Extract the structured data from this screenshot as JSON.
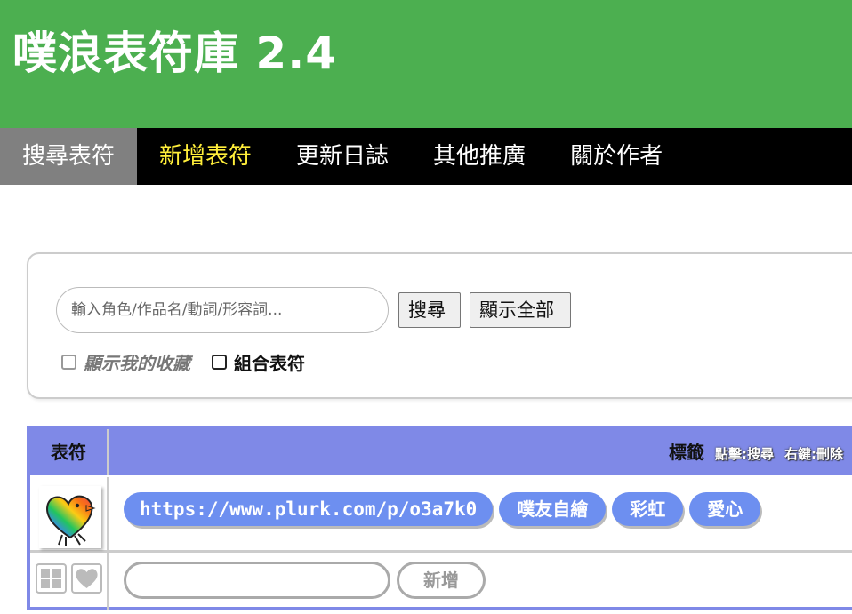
{
  "header": {
    "title": "噗浪表符庫 2.4",
    "background": "#4caf50"
  },
  "nav": [
    {
      "label": "搜尋表符",
      "state": "active"
    },
    {
      "label": "新增表符",
      "state": "highlight"
    },
    {
      "label": "更新日誌",
      "state": "normal"
    },
    {
      "label": "其他推廣",
      "state": "normal"
    },
    {
      "label": "關於作者",
      "state": "normal"
    }
  ],
  "search": {
    "placeholder": "輸入角色/作品名/動詞/形容詞...",
    "value": "",
    "search_button": "搜尋",
    "show_all_button": "顯示全部",
    "show_favorites_label": "顯示我的收藏",
    "show_favorites_checked": false,
    "combine_label": "組合表符",
    "combine_checked": false
  },
  "table": {
    "header_emoji": "表符",
    "header_tags": "標籤",
    "hint_click": "點擊:搜尋",
    "hint_right": "右鍵:刪除",
    "rows": [
      {
        "emoji_icon": "rainbow-heart-bird-icon",
        "tags": [
          "https://www.plurk.com/p/o3a7k0",
          "噗友自繪",
          "彩虹",
          "愛心"
        ]
      }
    ],
    "new_tag": {
      "value": "",
      "add_button": "新增"
    },
    "accent": "#7f89e7",
    "tag_color": "#6d8ff0"
  }
}
